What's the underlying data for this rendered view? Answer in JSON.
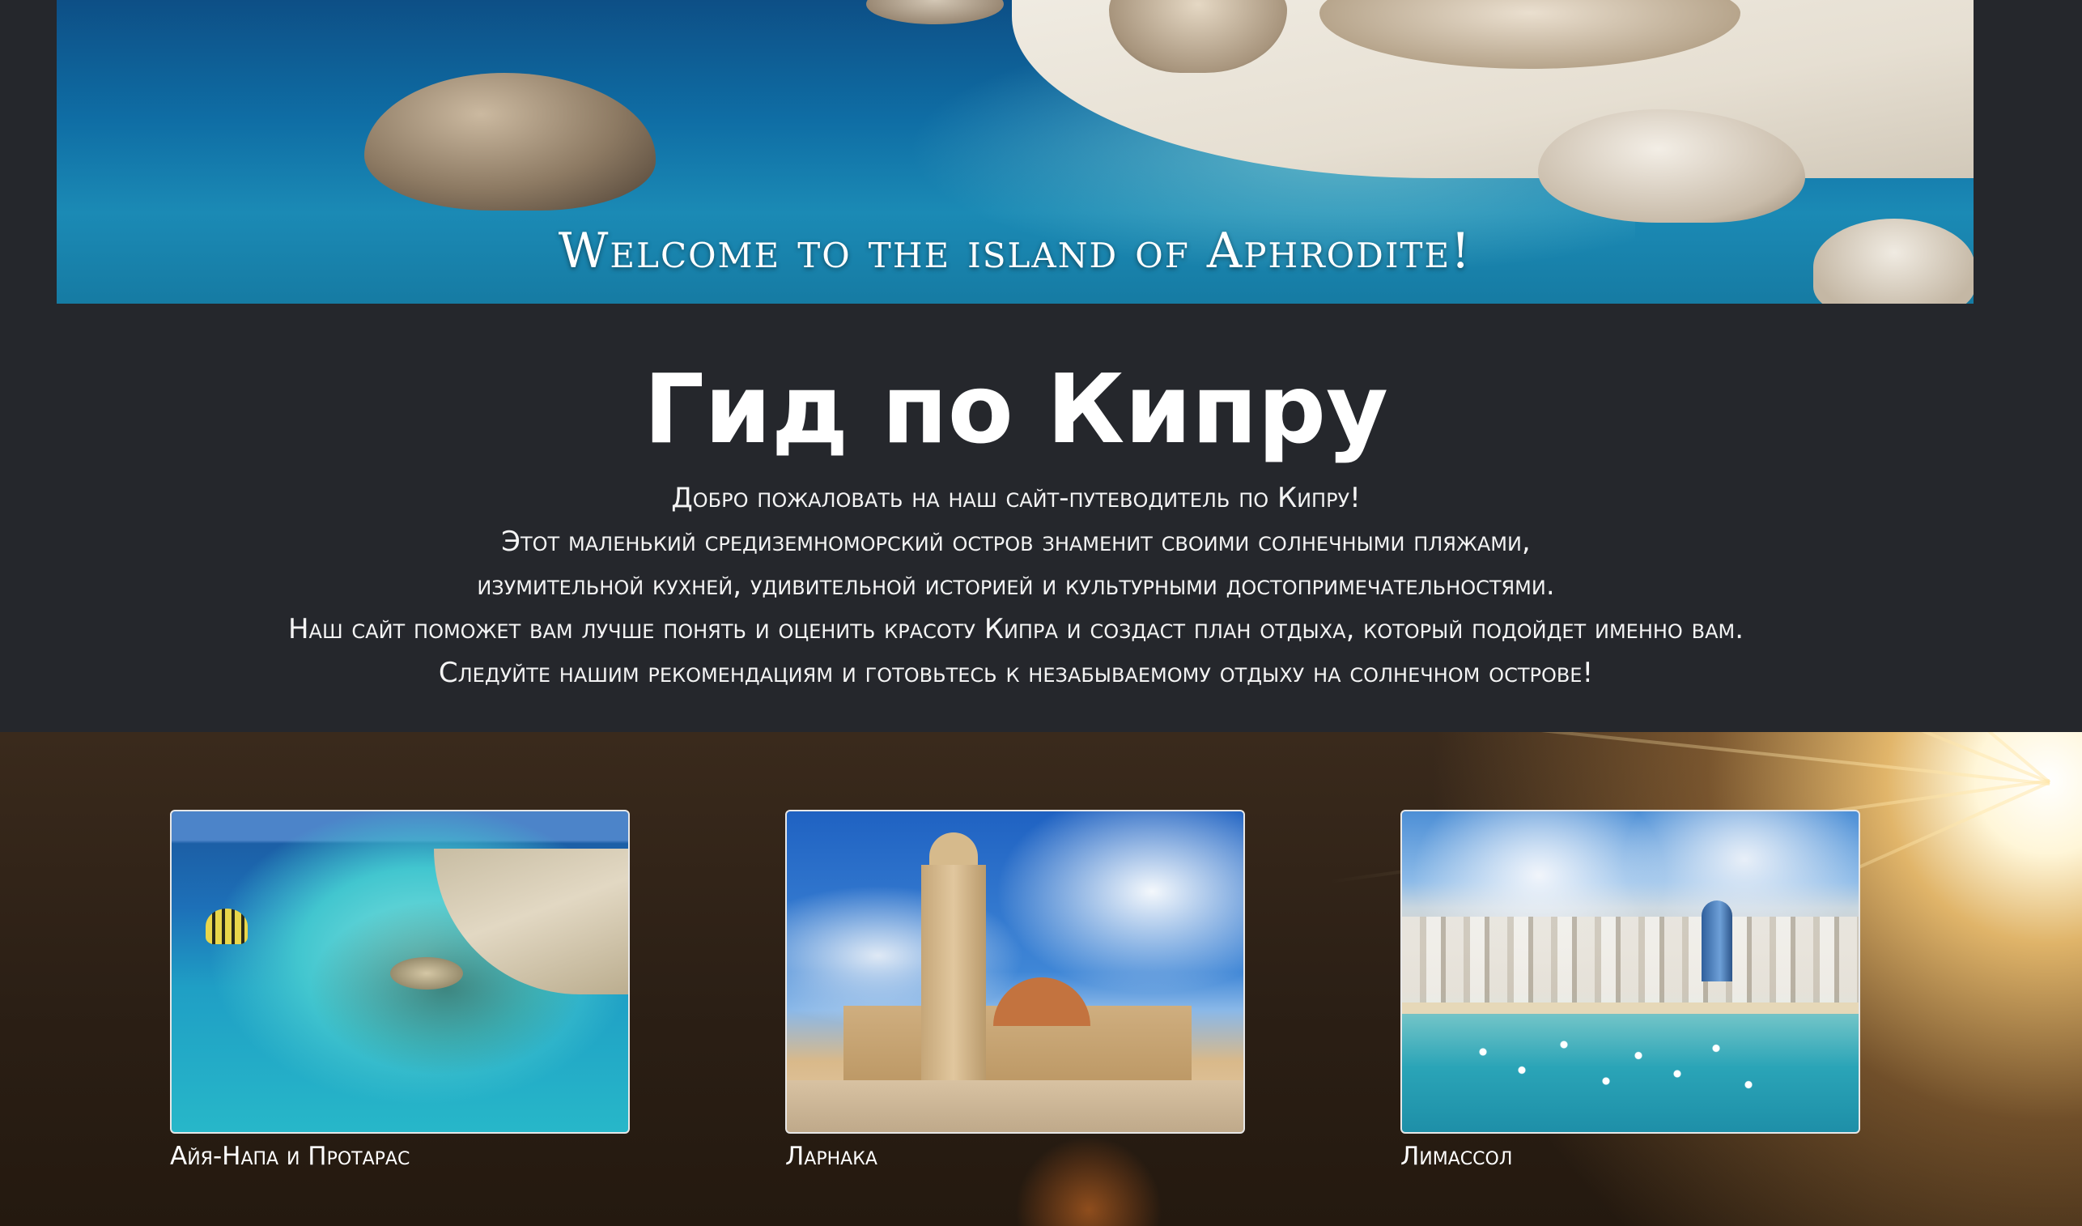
{
  "hero": {
    "welcome_text": "Welcome to the island of Aphrodite!"
  },
  "intro": {
    "title": "Гид по Кипру",
    "lines": [
      "Добро пожаловать на наш сайт-путеводитель по Кипру!",
      "Этот маленький средиземноморский остров знаменит своими солнечными пляжами,",
      "изумительной кухней, удивительной историей и культурными достопримечательностями.",
      "Наш сайт поможет вам лучше понять и оценить красоту Кипра и создаст план отдыха, который подойдет именно вам.",
      "Следуйте нашим рекомендациям и готовьтесь к незабываемому отдыху на солнечном острове!"
    ]
  },
  "cities": [
    {
      "label": "Айя-Напа и Протарас"
    },
    {
      "label": "Ларнака"
    },
    {
      "label": "Лимассол"
    }
  ],
  "colors": {
    "page_background": "#25272c",
    "text": "#ffffff"
  }
}
